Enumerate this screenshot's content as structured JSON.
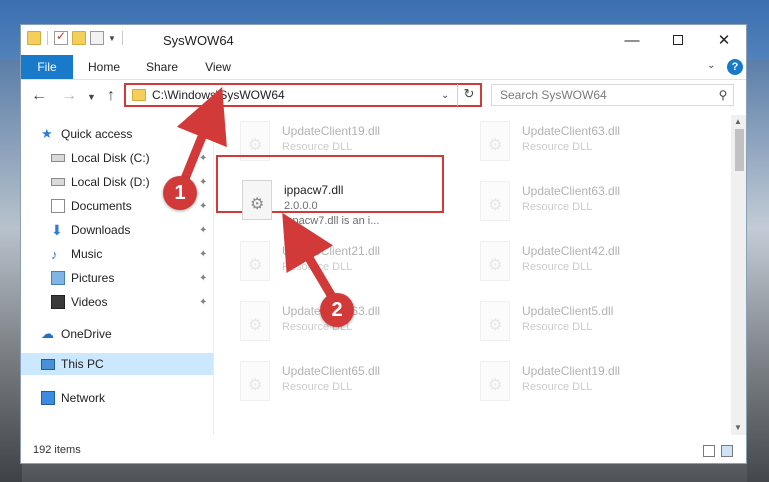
{
  "window": {
    "title": "SysWOW64",
    "controls": {
      "minimize": "—",
      "close": "✕"
    }
  },
  "ribbon": {
    "tabs": [
      "File",
      "Home",
      "Share",
      "View"
    ],
    "help": "?"
  },
  "navigation": {
    "address": "C:\\Windows\\SysWOW64",
    "search_placeholder": "Search SysWOW64"
  },
  "sidebar": {
    "items": [
      {
        "label": "Quick access",
        "icon": "star-icon"
      },
      {
        "label": "Local Disk (C:)",
        "icon": "disk-icon",
        "pinned": true
      },
      {
        "label": "Local Disk (D:)",
        "icon": "disk-icon",
        "pinned": true
      },
      {
        "label": "Documents",
        "icon": "documents-icon",
        "pinned": true
      },
      {
        "label": "Downloads",
        "icon": "downloads-icon",
        "pinned": true
      },
      {
        "label": "Music",
        "icon": "music-icon",
        "pinned": true
      },
      {
        "label": "Pictures",
        "icon": "pictures-icon",
        "pinned": true
      },
      {
        "label": "Videos",
        "icon": "videos-icon",
        "pinned": true
      },
      {
        "label": "OneDrive",
        "icon": "cloud-icon"
      },
      {
        "label": "This PC",
        "icon": "computer-icon",
        "selected": true
      },
      {
        "label": "Network",
        "icon": "network-icon"
      }
    ]
  },
  "files": {
    "highlighted": {
      "name": "ippacw7.dll",
      "version": "2.0.0.0",
      "desc": "ippacw7.dll is an i..."
    },
    "background": [
      {
        "name": "UpdateClient19.dll",
        "type": "Resource DLL"
      },
      {
        "name": "UpdateClient63.dll",
        "type": "Resource DLL"
      },
      {
        "name": "UpdateClient63.dll",
        "type": "Resource DLL"
      },
      {
        "name": "UpdateClient42.dll",
        "type": "Resource DLL"
      },
      {
        "name": "UpdateClient21.dll",
        "type": "Resource DLL"
      },
      {
        "name": "UpdateClient63.dll",
        "type": "Resource DLL"
      },
      {
        "name": "UpdateClient5.dll",
        "type": "Resource DLL"
      },
      {
        "name": "UpdateClient65.dll",
        "type": "Resource DLL"
      },
      {
        "name": "UpdateClient19.dll",
        "type": "Resource DLL"
      }
    ]
  },
  "status": {
    "count": "192 items"
  },
  "annotations": {
    "step1": "1",
    "step2": "2",
    "accent": "#d23a3a"
  }
}
